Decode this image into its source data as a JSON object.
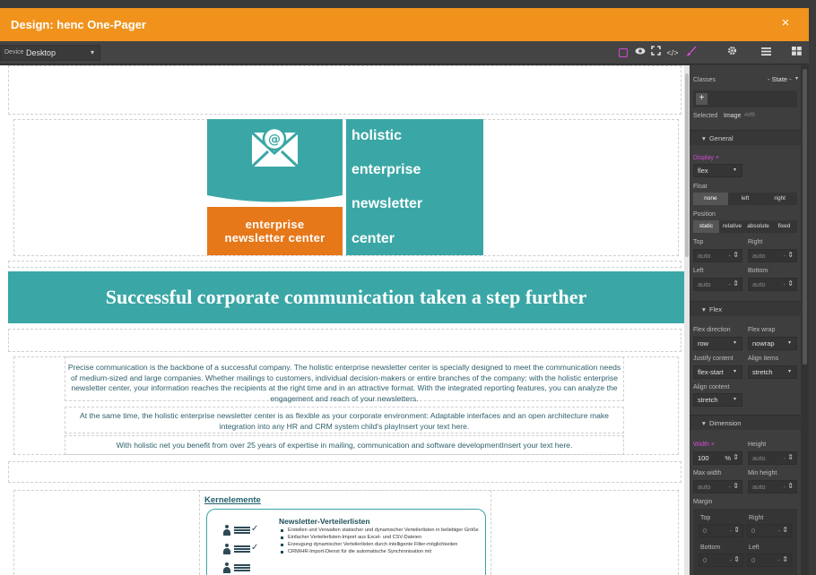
{
  "window": {
    "title": "Design: henc One-Pager",
    "close_glyph": "×"
  },
  "toolbar": {
    "device_label": "Device",
    "device_value": "Desktop",
    "icons": [
      "outline-toggle-icon",
      "eye-preview-icon",
      "fullscreen-icon",
      "code-icon",
      "brush-icon",
      "gear-icon",
      "hamburger-menu-icon",
      "blocks-grid-icon"
    ],
    "accent_color": "#d24ad6",
    "bar_color": "#f0921c"
  },
  "logo": {
    "left_line1": "enterprise",
    "left_line2": "newsletter center",
    "right_lines": [
      "holistic",
      "enterprise",
      "newsletter",
      "center"
    ],
    "teal": "#3aa7a6",
    "orange": "#e6781a"
  },
  "banner": {
    "text": "Successful corporate communication taken a step further"
  },
  "paragraphs": {
    "p1": "Precise communication is the backbone of a successful company. The holistic enterprise newsletter center is specially designed to meet the communication needs of medium-sized and large companies. Whether mailings to customers, individual decision-makers or entire branches of the company: with the holistic enterprise newsletter center, your information reaches the recipients at the right time and in an attractive format. With the integrated reporting features, you can analyze the engagement and reach of your newsletters.",
    "p2": "At the same time, the holistic enterprise newsletter center is as flexible as your corporate environment: Adaptable interfaces and an open architecture make integration into any HR and CRM system child's playInsert your text here.",
    "p3": "With holistic net you benefit from over 25 years of expertise in mailing, communication and software developmentInsert your text here."
  },
  "key_elements": {
    "title": "Kernelemente",
    "card_heading": "Newsletter-Verteilerlisten",
    "bullets": [
      "Erstellen und Verwalten statischer und dynamischer Verteilerlisten in beliebiger Größe",
      "Einfacher Verteilerlisten-Import aus Excel- und CSV-Dateien",
      "Erzeugung dynamischer Verteilerlisten durch intelligente Filter-möglichkeiten",
      "CRM/HR-Import-Dienst für die automatische Synchronisation mit"
    ]
  },
  "panel": {
    "classes_label": "Classes",
    "state_value": "- State -",
    "add_button": "+",
    "selected_label": "Selected",
    "selected_value": "Image",
    "selected_id": "#irf9",
    "general_title": "General",
    "display_label": "Display",
    "display_value": "flex",
    "float_label": "Float",
    "float_options": [
      "none",
      "left",
      "right"
    ],
    "position_label": "Position",
    "position_options": [
      "static",
      "relative",
      "absolute",
      "fixed"
    ],
    "top_label": "Top",
    "right_label": "Right",
    "left_label": "Left",
    "bottom_label": "Bottom",
    "auto": "auto",
    "dash": "-",
    "flex_title": "Flex",
    "flex_direction_label": "Flex direction",
    "flex_direction_value": "row",
    "flex_wrap_label": "Flex wrap",
    "flex_wrap_value": "nowrap",
    "justify_label": "Justify content",
    "justify_value": "flex-start",
    "align_items_label": "Align items",
    "align_items_value": "stretch",
    "align_content_label": "Align content",
    "align_content_value": "stretch",
    "dimension_title": "Dimension",
    "width_label": "Width",
    "width_value": "100",
    "width_unit": "%",
    "height_label": "Height",
    "max_width_label": "Max width",
    "min_height_label": "Min height",
    "margin_label": "Margin",
    "margin_top_label": "Top",
    "margin_right_label": "Right",
    "margin_bottom_label": "Bottom",
    "margin_left_label": "Left",
    "zero": "0",
    "remove_glyph": "×"
  }
}
